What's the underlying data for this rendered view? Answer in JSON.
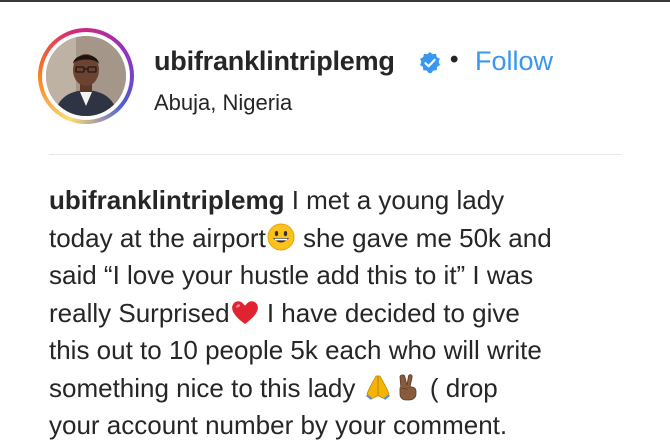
{
  "post_header": {
    "username": "ubifranklintriplemg",
    "separator": "•",
    "follow_label": "Follow",
    "location": "Abuja, Nigeria",
    "verified_icon": "verified-badge-icon"
  },
  "caption": {
    "username": "ubifranklintriplemg",
    "line1_text": " I met a young lady",
    "line2_text_a": "today at the airport",
    "line2_text_b": " she gave me 50k and",
    "line3_text": "said “I love your hustle add this to it” I was",
    "line4_text_a": "really Surprised",
    "line4_text_b": " I have decided to give",
    "line5_text": "this out to 10 people 5k each who will write",
    "line6_text_a": "something nice to this lady ",
    "line6_text_b": " ( drop",
    "line7_text": "your account number by your comment.",
    "emojis": [
      "grinning-face",
      "red-heart",
      "folded-hands",
      "folded-hands",
      "victory-hand"
    ]
  },
  "colors": {
    "link_blue": "#3897f0",
    "text": "#262626",
    "divider": "#e6e6e6"
  }
}
